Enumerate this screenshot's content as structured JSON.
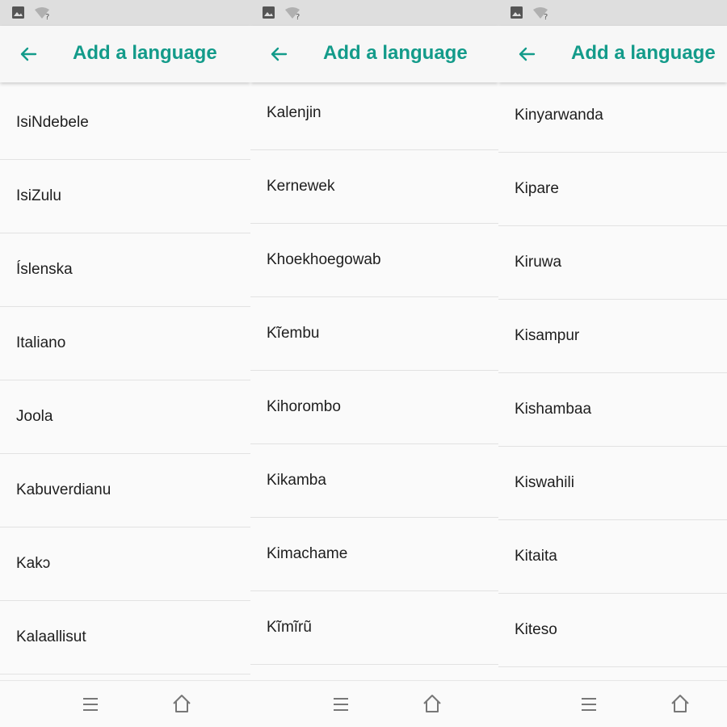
{
  "accent_color": "#139b8a",
  "icons": {
    "status_image": "image-icon",
    "status_wifi": "wifi-unknown-icon",
    "back": "arrow-left-icon",
    "nav_menu": "menu-icon",
    "nav_home": "home-icon"
  },
  "screens": [
    {
      "title": "Add a language",
      "items": [
        "IsiNdebele",
        "IsiZulu",
        "Íslenska",
        "Italiano",
        "Joola",
        "Kabuverdianu",
        "Kakɔ",
        "Kalaallisut"
      ]
    },
    {
      "title": "Add a language",
      "items": [
        "Kalenjin",
        "Kernewek",
        "Khoekhoegowab",
        "Kĩembu",
        "Kihorombo",
        "Kikamba",
        "Kimachame",
        "Kĩmĩrũ"
      ]
    },
    {
      "title": "Add a language",
      "items": [
        "Kinyarwanda",
        "Kipare",
        "Kiruwa",
        "Kisampur",
        "Kishambaa",
        "Kiswahili",
        "Kitaita",
        "Kiteso"
      ]
    }
  ]
}
